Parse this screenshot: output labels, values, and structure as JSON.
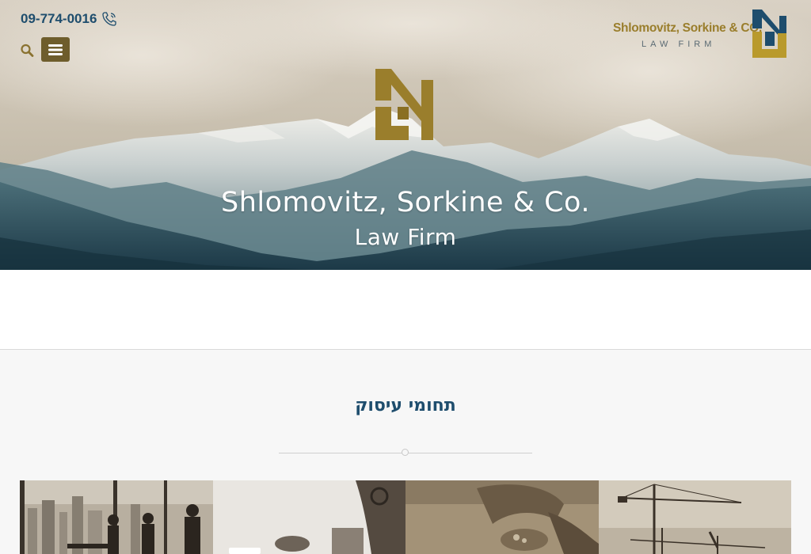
{
  "header": {
    "phone": "09-774-0016",
    "phone_icon": "phone-icon",
    "search_icon": "search-icon",
    "menu_icon": "hamburger-menu-icon",
    "brand_name": "Shlomovitz, Sorkine & CO.",
    "brand_tagline": "LAW FIRM"
  },
  "hero": {
    "title": "Shlomovitz, Sorkine & Co.",
    "subtitle": "Law Firm"
  },
  "section": {
    "title": "תחומי עיסוק"
  },
  "colors": {
    "brand_gold": "#9a7e2c",
    "brand_navy": "#1e4d6d",
    "menu_button": "#6e5d2c"
  }
}
